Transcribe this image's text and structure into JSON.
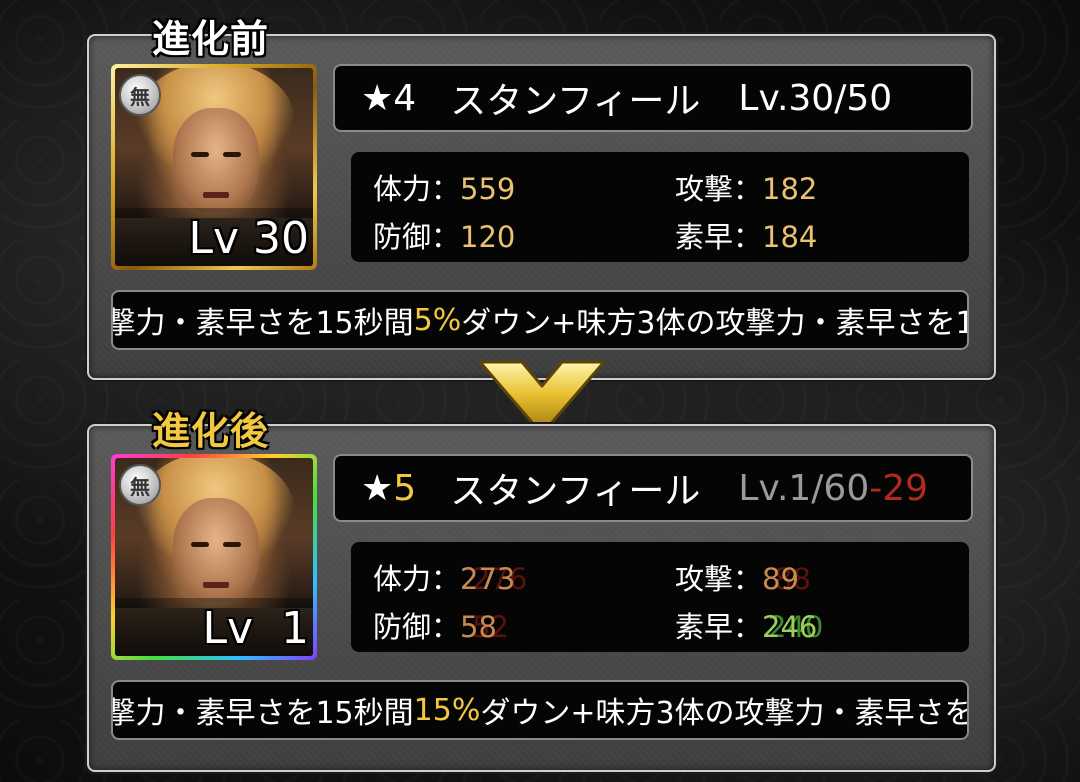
{
  "before": {
    "title": "進化前",
    "portrait_level": "Lv 30",
    "badge": "無",
    "frame_color": "#d8a520",
    "star": "★4",
    "name": "スタンフィール",
    "level": "Lv.30/50",
    "stats": {
      "hp_label": "体力：",
      "hp": "559",
      "atk_label": "攻撃：",
      "atk": "182",
      "def_label": "防御：",
      "def": "120",
      "spd_label": "素早：",
      "spd": "184"
    },
    "skill_pre": "撃力・素早さを15秒間",
    "skill_hl": "5%",
    "skill_post": "ダウン+味方3体の攻撃力・素早さを1"
  },
  "after": {
    "title": "進化後",
    "portrait_level": "Lv  1",
    "badge": "無",
    "frame_color": "rainbow",
    "star_symbol": "★",
    "star_num": "5",
    "name": "スタンフィール",
    "level": "Lv.1/60",
    "level_diff": "-29",
    "stats": {
      "hp_label": "体力：",
      "hp": "273",
      "hp_prev": "276",
      "atk_label": "攻撃：",
      "atk": "89",
      "atk_prev": "88",
      "def_label": "防御：",
      "def": "58",
      "def_prev": "52",
      "spd_label": "素早：",
      "spd": "246",
      "spd_prev": "240"
    },
    "skill_pre": "撃力・素早さを15秒間",
    "skill_hl": "15%",
    "skill_post": "ダウン+味方3体の攻撃力・素早さを"
  },
  "colors": {
    "highlight": "#f2c840",
    "stat_value": "#e9c270",
    "decrease": "#b02a20",
    "increase": "#46aa3c"
  }
}
